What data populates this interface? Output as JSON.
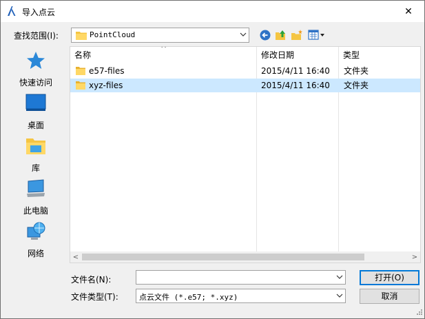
{
  "window": {
    "title": "导入点云",
    "close_glyph": "✕"
  },
  "lookin": {
    "label": "查找范围(I):",
    "value": "PointCloud"
  },
  "toolbar": {
    "icons": [
      "back-icon",
      "up-folder-icon",
      "new-folder-icon",
      "view-menu-icon"
    ]
  },
  "places": [
    {
      "label": "快速访问",
      "icon": "star-icon"
    },
    {
      "label": "桌面",
      "icon": "desktop-icon"
    },
    {
      "label": "库",
      "icon": "library-icon"
    },
    {
      "label": "此电脑",
      "icon": "computer-icon"
    },
    {
      "label": "网络",
      "icon": "network-icon"
    }
  ],
  "filelist": {
    "columns": [
      "名称",
      "修改日期",
      "类型"
    ],
    "sort_glyph": "^",
    "rows": [
      {
        "name": "e57-files",
        "date": "2015/4/11 16:40",
        "type": "文件夹",
        "selected": false
      },
      {
        "name": "xyz-files",
        "date": "2015/4/11 16:40",
        "type": "文件夹",
        "selected": true
      }
    ],
    "scroll_left": "<",
    "scroll_right": ">"
  },
  "filename": {
    "label": "文件名(N):",
    "value": ""
  },
  "filetype": {
    "label": "文件类型(T):",
    "value": "点云文件 (*.e57; *.xyz)"
  },
  "buttons": {
    "open": "打开(O)",
    "cancel": "取消"
  },
  "colors": {
    "selection": "#cce8ff",
    "accent": "#0078d7"
  }
}
